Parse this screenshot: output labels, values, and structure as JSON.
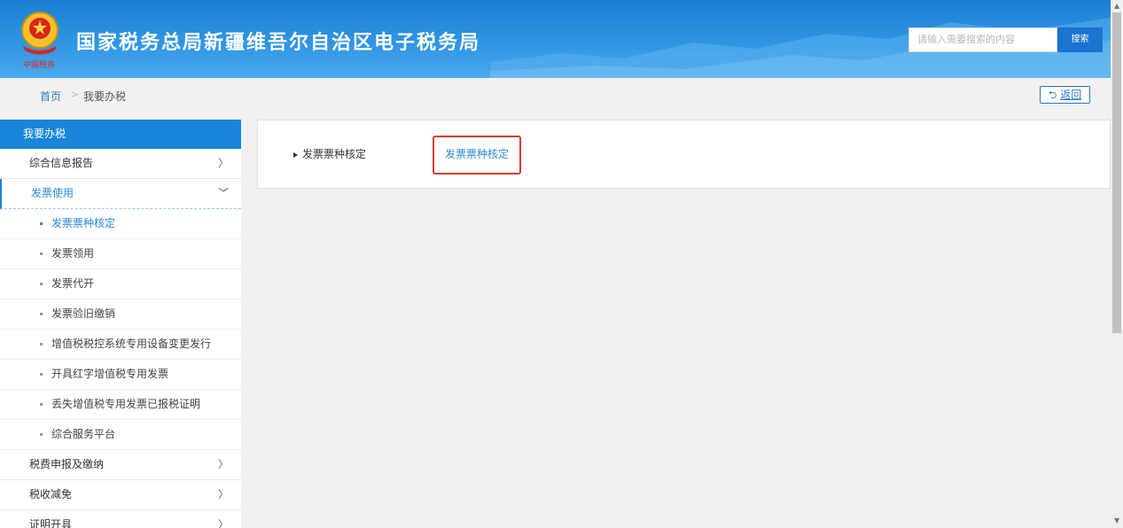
{
  "header": {
    "site_title": "国家税务总局新疆维吾尔自治区电子税务局",
    "emblem_icon": "national-emblem-icon",
    "search_placeholder": "请输入需要搜索的内容",
    "search_button": "搜索"
  },
  "breadcrumb": {
    "home": "首页",
    "separator": ">",
    "current": "我要办税",
    "back_label": "返回"
  },
  "sidebar": {
    "title": "我要办税",
    "items": [
      {
        "label": "综合信息报告",
        "chevron": "〉"
      },
      {
        "label": "发票使用",
        "chevron": "﹀"
      },
      {
        "label": "税费申报及缴纳",
        "chevron": "〉"
      },
      {
        "label": "税收减免",
        "chevron": "〉"
      },
      {
        "label": "证明开具",
        "chevron": "〉"
      }
    ],
    "subitems": [
      {
        "label": "发票票种核定"
      },
      {
        "label": "发票领用"
      },
      {
        "label": "发票代开"
      },
      {
        "label": "发票验旧缴销"
      },
      {
        "label": "增值税税控系统专用设备变更发行"
      },
      {
        "label": "开具红字增值税专用发票"
      },
      {
        "label": "丢失增值税专用发票已报税证明"
      },
      {
        "label": "综合服务平台"
      }
    ]
  },
  "main": {
    "section_label": "发票票种核定",
    "link_label": "发票票种核定"
  },
  "colors": {
    "header_blue": "#2f95e3",
    "accent_blue": "#1a86d9",
    "link_blue": "#2b8ad8",
    "highlight_red": "#e03a2f"
  }
}
